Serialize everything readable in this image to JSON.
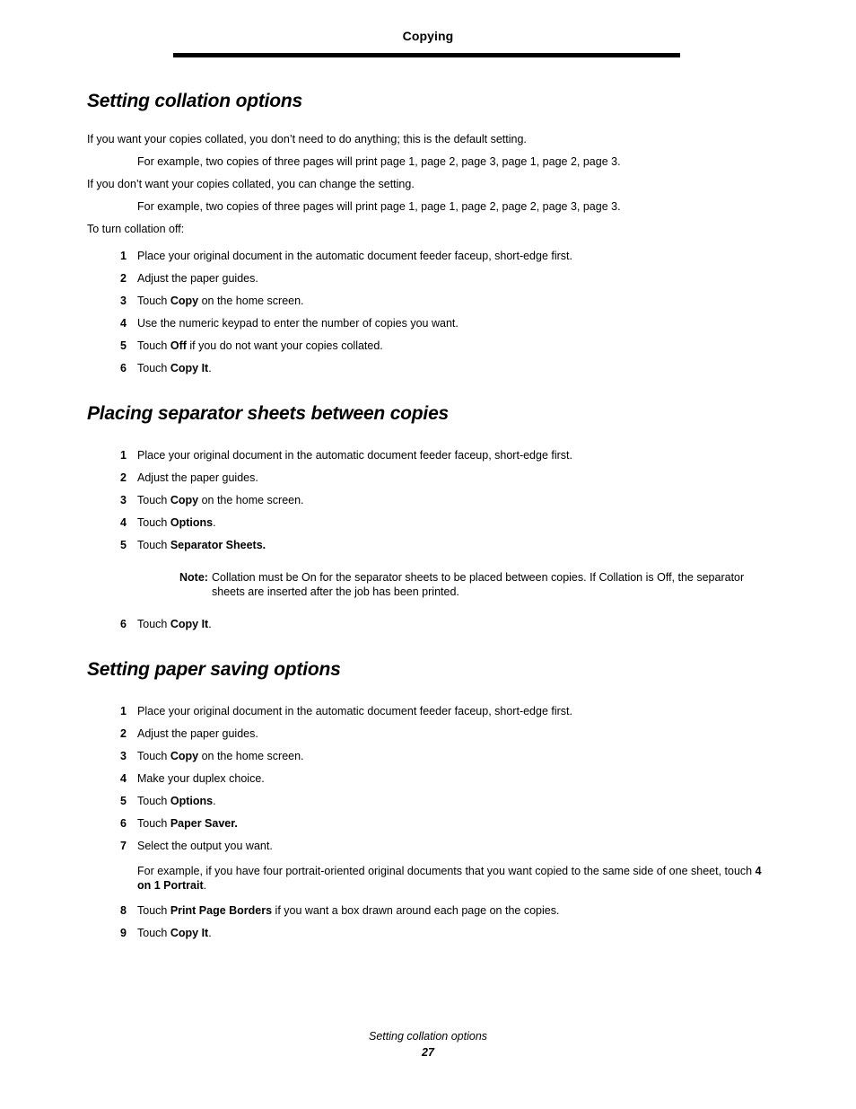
{
  "header": {
    "title": "Copying"
  },
  "footer": {
    "title": "Setting collation options",
    "page_number": "27"
  },
  "sections": [
    {
      "heading": "Setting collation options",
      "intro": [
        {
          "kind": "body",
          "text": "If you want your copies collated, you don’t need to do anything; this is the default setting."
        },
        {
          "kind": "example",
          "text": "For example, two copies of three pages will print page 1, page 2, page 3, page 1, page 2, page 3."
        },
        {
          "kind": "body",
          "text": "If you don’t want your copies collated, you can change the setting."
        },
        {
          "kind": "example",
          "text": "For example, two copies of three pages will print page 1, page 1, page 2, page 2, page 3, page 3."
        },
        {
          "kind": "body",
          "text": "To turn collation off:"
        }
      ],
      "steps": [
        {
          "num": "1",
          "html": "Place your original document in the automatic document feeder faceup, short-edge first."
        },
        {
          "num": "2",
          "html": "Adjust the paper guides."
        },
        {
          "num": "3",
          "html": "Touch <b>Copy</b> on the home screen."
        },
        {
          "num": "4",
          "html": "Use the numeric keypad to enter the number of copies you want."
        },
        {
          "num": "5",
          "html": "Touch <b>Off</b> if you do not want your copies collated."
        },
        {
          "num": "6",
          "html": "Touch <b>Copy It</b>."
        }
      ]
    },
    {
      "heading": "Placing separator sheets between copies",
      "steps": [
        {
          "num": "1",
          "html": "Place your original document in the automatic document feeder faceup, short-edge first."
        },
        {
          "num": "2",
          "html": "Adjust the paper guides."
        },
        {
          "num": "3",
          "html": "Touch <b>Copy</b> on the home screen."
        },
        {
          "num": "4",
          "html": "Touch <b>Options</b>."
        },
        {
          "num": "5",
          "html": "Touch <b>Separator Sheets.</b>"
        },
        {
          "num": "6",
          "html": "Touch <b>Copy It</b>."
        }
      ],
      "note": {
        "label": "Note:",
        "text": "Collation must be On for the separator sheets to be placed between copies. If Collation is Off, the separator sheets are inserted after the job has been printed."
      }
    },
    {
      "heading": "Setting paper saving options",
      "steps": [
        {
          "num": "1",
          "html": "Place your original document in the automatic document feeder faceup, short-edge first."
        },
        {
          "num": "2",
          "html": "Adjust the paper guides."
        },
        {
          "num": "3",
          "html": "Touch <b>Copy</b> on the home screen."
        },
        {
          "num": "4",
          "html": "Make your duplex choice."
        },
        {
          "num": "5",
          "html": "Touch <b>Options</b>."
        },
        {
          "num": "6",
          "html": "Touch <b>Paper Saver.</b>"
        },
        {
          "num": "7",
          "html": "Select the output you want."
        },
        {
          "num": "8",
          "html": "Touch <b>Print Page Borders</b> if you want a box drawn around each page on the copies."
        },
        {
          "num": "9",
          "html": "Touch <b>Copy It</b>."
        }
      ],
      "step7_example": "For example, if you have four portrait-oriented original documents that you want copied to the same side of one sheet, touch <b>4 on 1 Portrait</b>."
    }
  ]
}
